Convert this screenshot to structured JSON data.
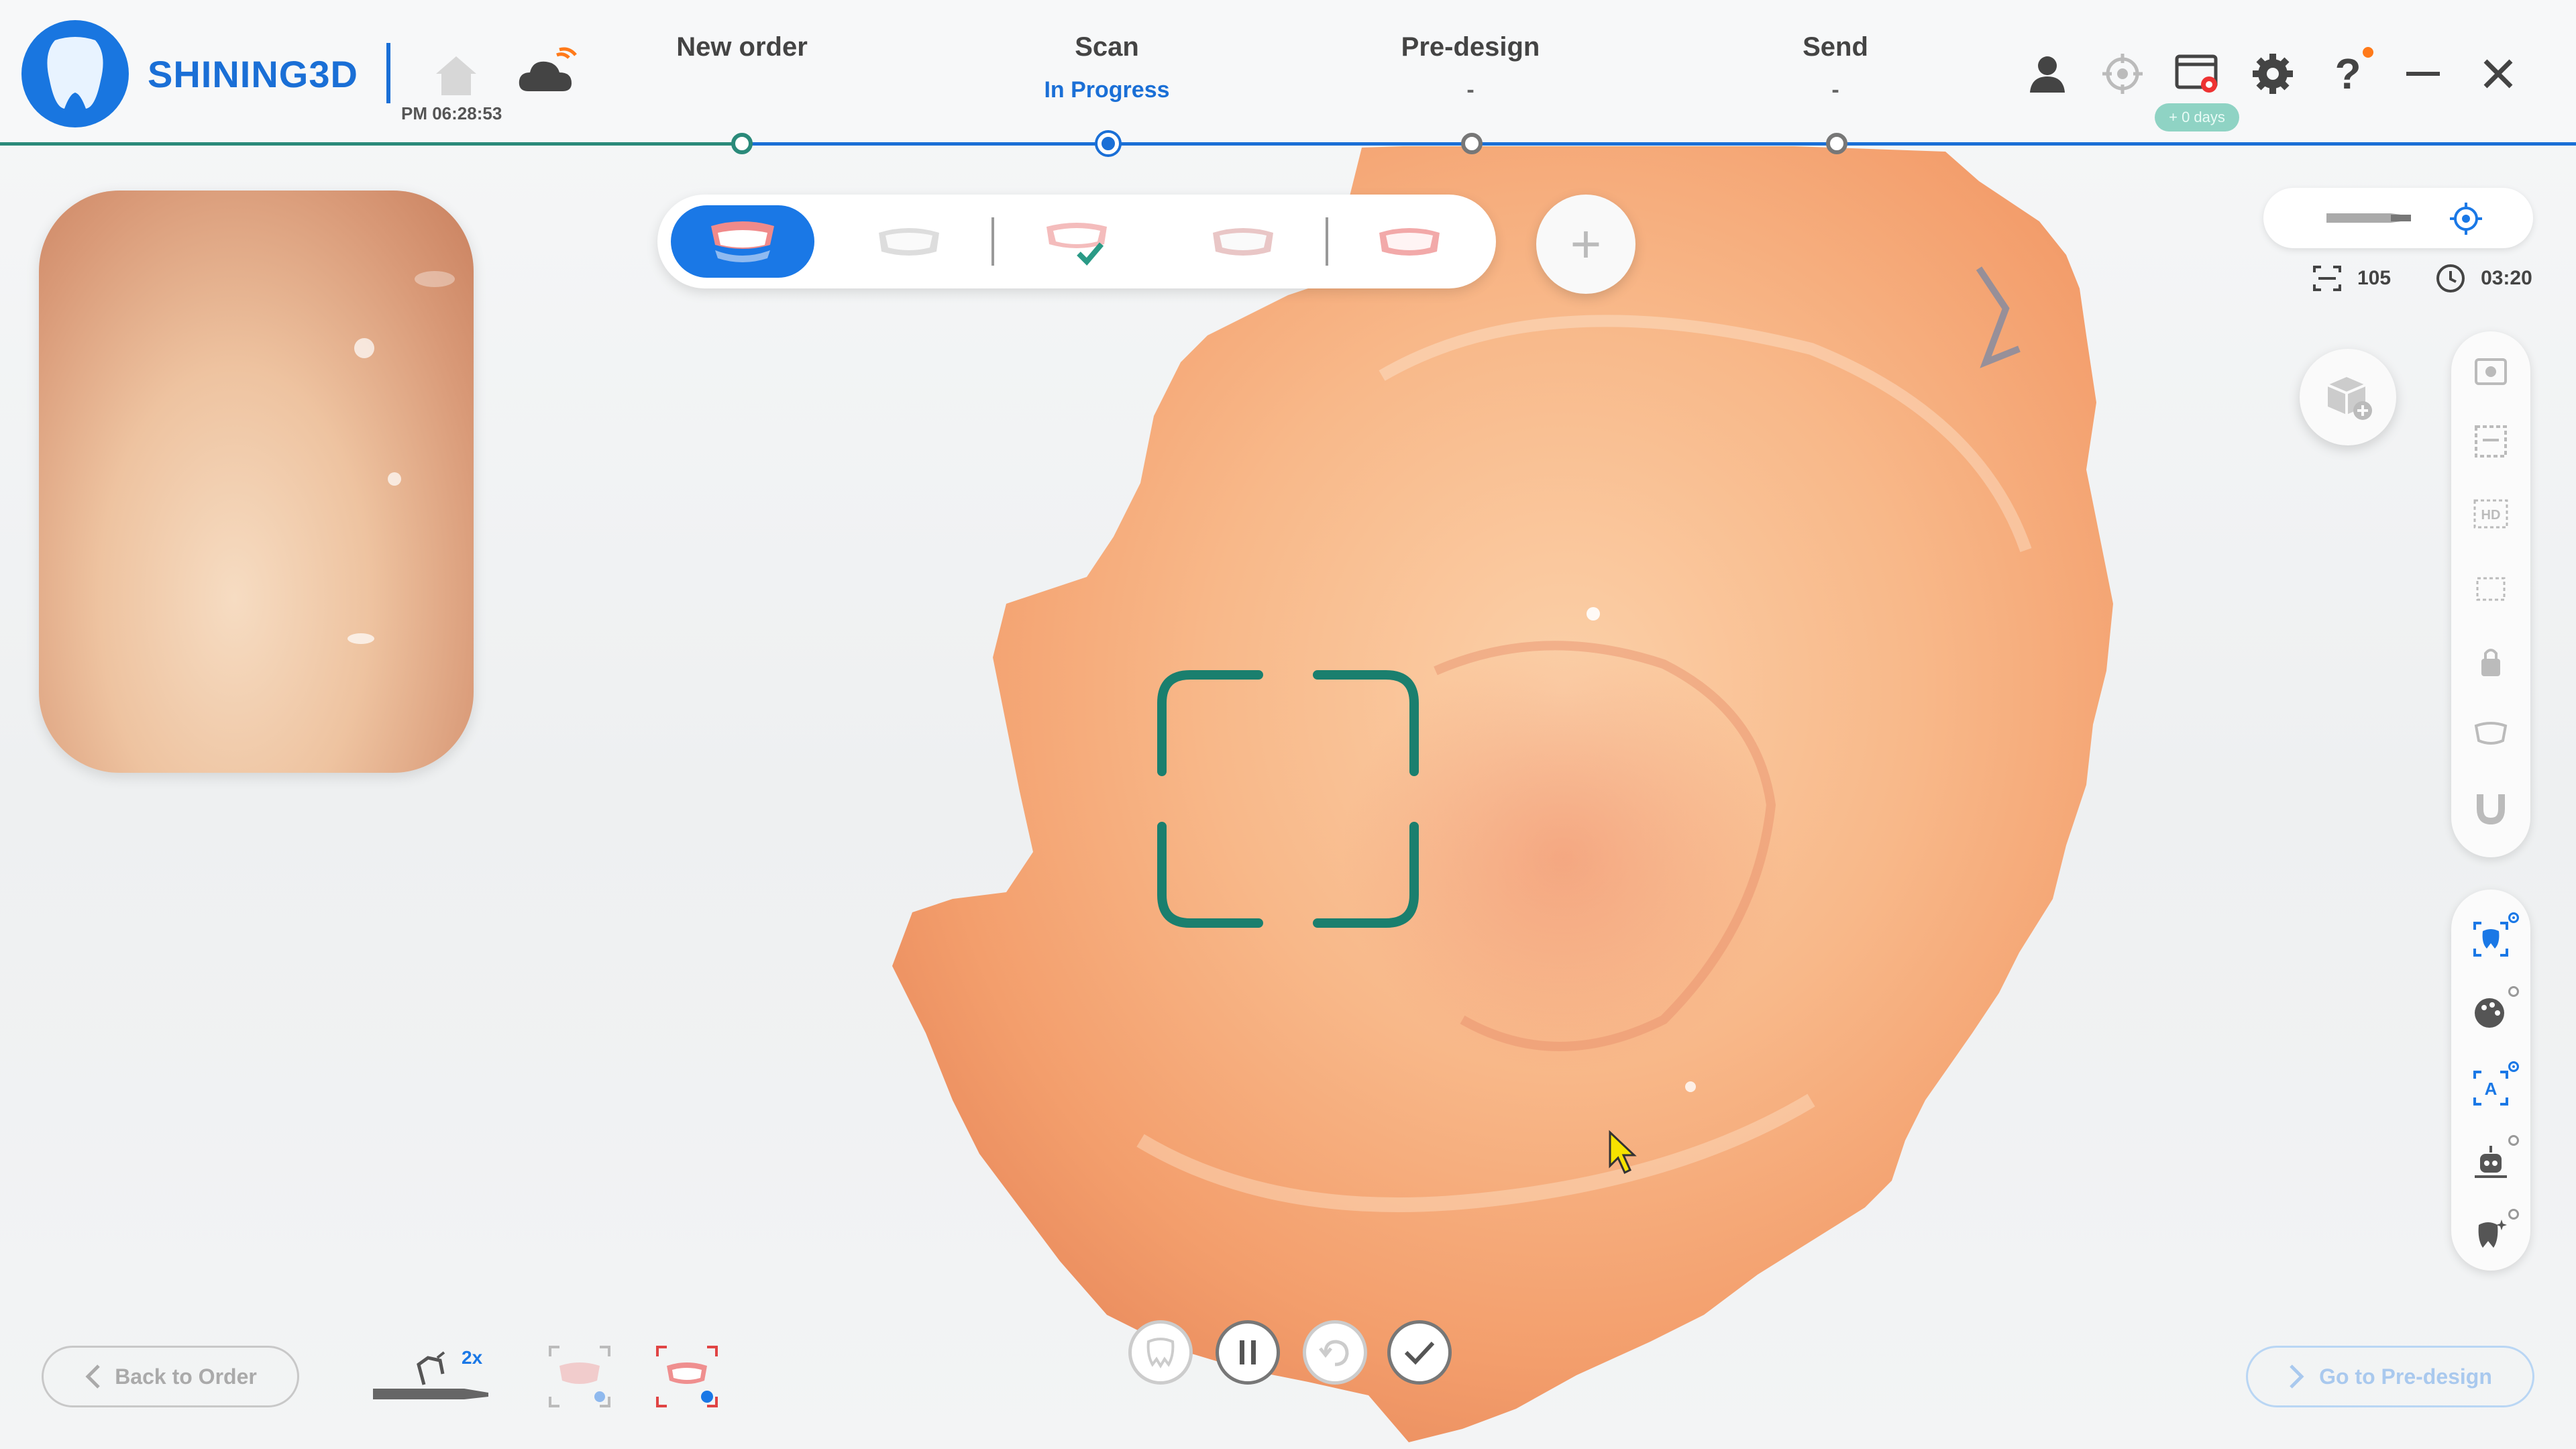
{
  "app": {
    "brand": "SHINING3D",
    "time": "PM 06:28:53"
  },
  "steps": [
    {
      "label": "New order",
      "status": ""
    },
    {
      "label": "Scan",
      "status": "In Progress"
    },
    {
      "label": "Pre-design",
      "status": "-"
    },
    {
      "label": "Send",
      "status": "-"
    }
  ],
  "header_icons": [
    "user-icon",
    "target-icon",
    "screen-record-icon",
    "settings-icon",
    "help-icon",
    "minimize-icon",
    "close-icon"
  ],
  "license_badge": "+ 0 days",
  "jaw_modes": [
    "upper-jaw",
    "lower-jaw",
    "bite-confirmed",
    "full-arch",
    "lower-arch"
  ],
  "device": {
    "frames": "105",
    "elapsed": "03:20"
  },
  "right_rail_top": [
    "blur-filter-icon",
    "grid-select-icon",
    "hd-icon",
    "region-select-icon",
    "lock-icon",
    "jaw-icon",
    "magnet-icon"
  ],
  "right_rail_bottom": [
    {
      "name": "tooth-scan-icon",
      "on": true
    },
    {
      "name": "texture-palette-icon",
      "on": false
    },
    {
      "name": "ai-scan-icon",
      "on": true
    },
    {
      "name": "robot-align-icon",
      "on": false
    },
    {
      "name": "tooth-sparkle-icon",
      "on": false
    }
  ],
  "bottom": {
    "back_label": "Back to Order",
    "next_label": "Go to Pre-design",
    "tip_zoom": "2x"
  },
  "colors": {
    "brand_blue": "#1a78e6",
    "progress_green": "#2a8a7a",
    "tissue": "#f3a877",
    "frame_teal": "#1a7f6e"
  }
}
